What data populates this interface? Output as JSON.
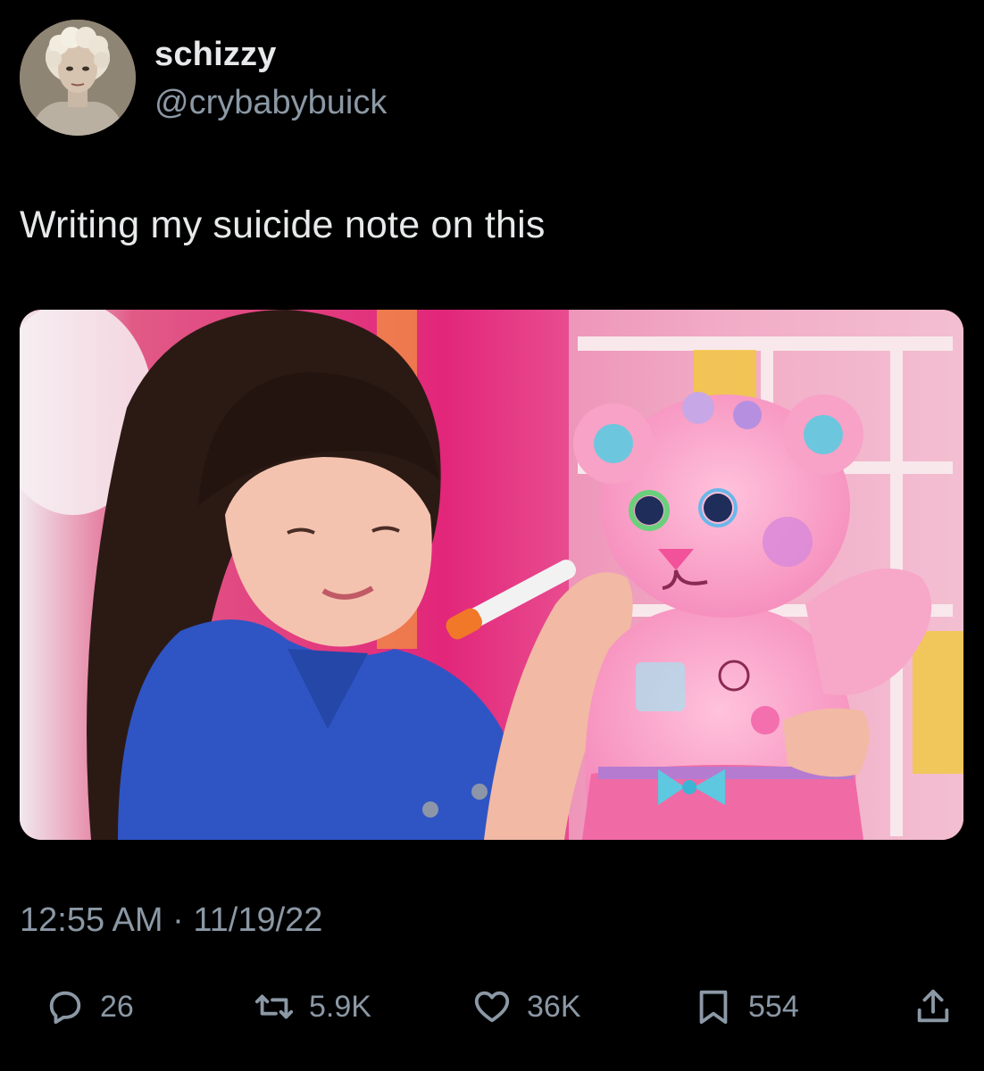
{
  "tweet": {
    "display_name": "schizzy",
    "handle": "@crybabybuick",
    "text": "Writing my suicide note on this",
    "timestamp": "12:55 AM · 11/19/22"
  },
  "actions": {
    "replies": "26",
    "retweets": "5.9K",
    "likes": "36K",
    "bookmarks": "554"
  },
  "icons": {
    "reply": "reply-icon",
    "retweet": "retweet-icon",
    "like": "heart-icon",
    "bookmark": "bookmark-icon",
    "share": "share-icon"
  },
  "colors": {
    "background": "#000000",
    "primary_text": "#e7e9ea",
    "secondary_text": "#8b98a5"
  }
}
